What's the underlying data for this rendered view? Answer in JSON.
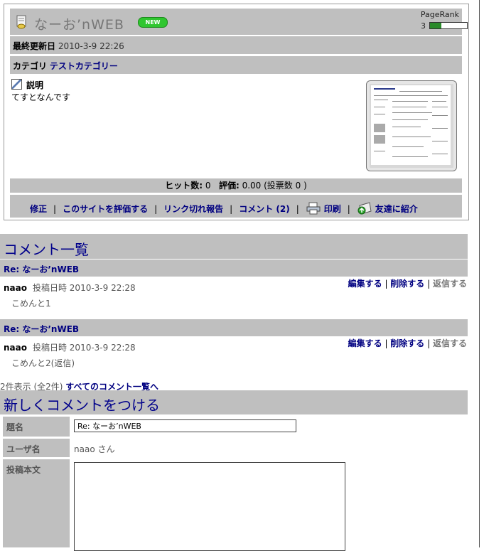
{
  "site": {
    "title": "なーお’nWEB",
    "new_badge": "NEW",
    "pagerank_label": "PageRank",
    "pagerank_value": "3",
    "pagerank_fraction": 0.3,
    "last_updated_label": "最終更新日",
    "last_updated_value": "2010-3-9 22:26",
    "category_label": "カテゴリ",
    "category_value": "テストカテゴリー",
    "description_label": "説明",
    "description_text": "てすとなんです",
    "hits_label": "ヒット数:",
    "hits_value": "0",
    "rating_label": "評価:",
    "rating_value": "0.00 (投票数 0 )",
    "links": {
      "edit": "修正",
      "rate": "このサイトを評価する",
      "broken": "リンク切れ報告",
      "comment": "コメント (2)",
      "print": "印刷",
      "tell_friend": "友達に紹介"
    }
  },
  "comments": {
    "header": "コメント一覧",
    "items": [
      {
        "title": "Re: なーお’nWEB",
        "user": "naao",
        "posted": "投稿日時 2010-3-9 22:28",
        "text": "こめんと1",
        "edit": "編集する",
        "delete": "削除する",
        "reply": "返信する"
      },
      {
        "title": "Re: なーお’nWEB",
        "user": "naao",
        "posted": "投稿日時 2010-3-9 22:28",
        "text": "こめんと2(返信)",
        "edit": "編集する",
        "delete": "削除する",
        "reply": "返信する"
      }
    ],
    "count_text": "2件表示 (全2件)",
    "all_link": "すべてのコメント一覧へ"
  },
  "new_comment": {
    "header": "新しくコメントをつける",
    "subject_label": "題名",
    "subject_value": "Re: なーお’nWEB",
    "user_label": "ユーザ名",
    "user_value": "naao さん",
    "body_label": "投稿本文",
    "body_value": ""
  }
}
